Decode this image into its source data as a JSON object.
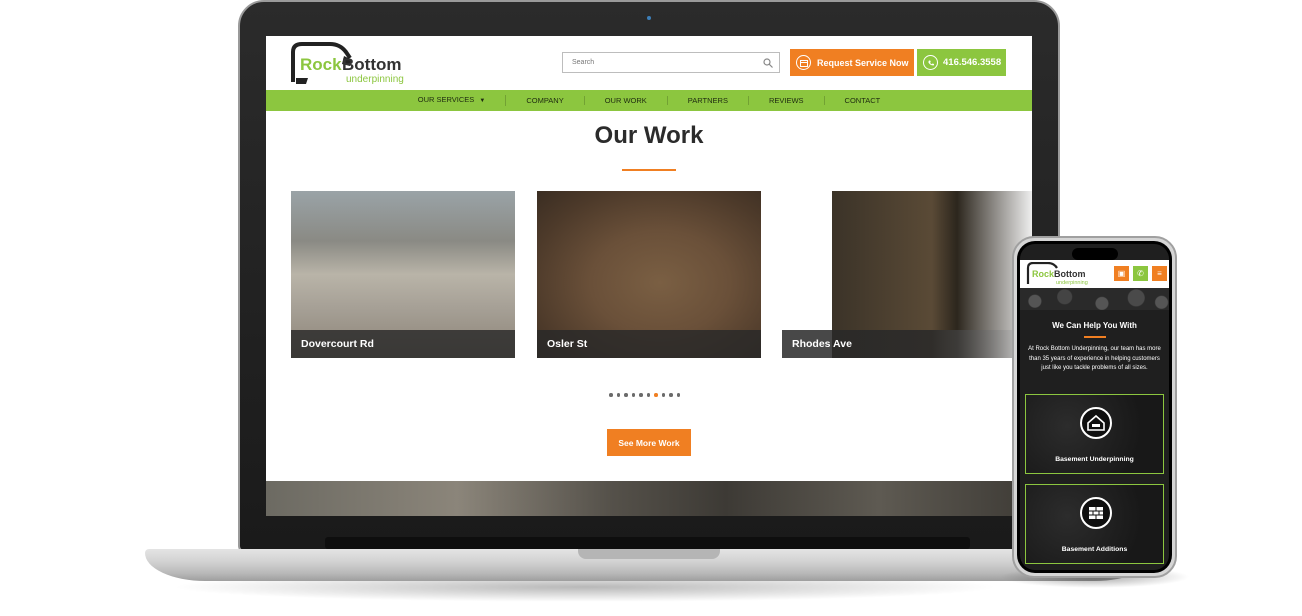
{
  "colors": {
    "orange": "#f07f22",
    "green": "#8cc63f",
    "dark": "#2b2b2b"
  },
  "laptop_site": {
    "logo": {
      "word1": "Rock",
      "word2": "Bottom",
      "tagline": "underpinning"
    },
    "search": {
      "placeholder": "Search",
      "icon": "search-icon"
    },
    "request_button": {
      "label": "Request Service Now",
      "icon": "calendar-icon"
    },
    "phone_button": {
      "label": "416.546.3558",
      "icon": "whatsapp-icon"
    },
    "nav": [
      {
        "label": "OUR SERVICES",
        "has_dropdown": true
      },
      {
        "label": "COMPANY"
      },
      {
        "label": "OUR WORK"
      },
      {
        "label": "PARTNERS"
      },
      {
        "label": "REVIEWS"
      },
      {
        "label": "CONTACT"
      }
    ],
    "heading": "Our Work",
    "projects": [
      {
        "caption": "Dovercourt Rd"
      },
      {
        "caption": "Osler St"
      },
      {
        "caption": "Rhodes Ave"
      }
    ],
    "carousel": {
      "dot_count": 10,
      "active_dot": 6
    },
    "see_more_button": "See More Work"
  },
  "phone_site": {
    "logo": {
      "word1": "Rock",
      "word2": "Bottom",
      "tagline": "underpinning"
    },
    "title": "We Can Help You With",
    "intro": "At Rock Bottom Underpinning, our team has more than 35 years of experience in helping customers just like you tackle problems of all sizes.",
    "services": [
      {
        "label": "Basement Underpinning",
        "icon": "house-icon"
      },
      {
        "label": "Basement Additions",
        "icon": "brick-wall-icon"
      }
    ]
  }
}
